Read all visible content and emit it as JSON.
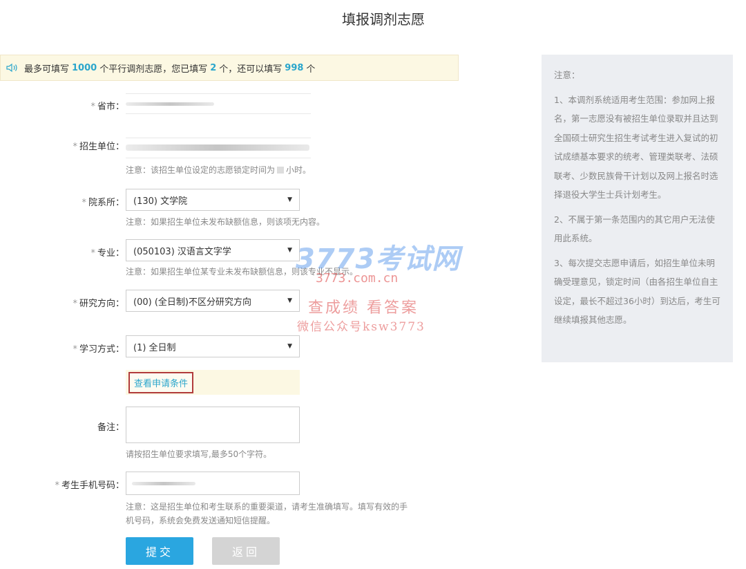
{
  "page": {
    "title": "填报调剂志愿"
  },
  "notice": {
    "prefix": "最多可填写",
    "max": "1000",
    "mid1": "个平行调剂志愿，您已填写",
    "filled": "2",
    "mid2": "个，还可以填写",
    "remaining": "998",
    "suffix": "个"
  },
  "form": {
    "required_mark": "*",
    "province_label": "省市：",
    "unit_label": "招生单位：",
    "unit_hint": "注意：该招生单位设定的志愿锁定时间为",
    "unit_hint_suffix": "小时。",
    "dept_label": "院系所：",
    "dept_value": "(130) 文学院",
    "dept_hint": "注意：如果招生单位未发布缺额信息，则该项无内容。",
    "major_label": "专业：",
    "major_value": "(050103) 汉语言文字学",
    "major_hint": "注意：如果招生单位某专业未发布缺额信息，则该专业不显示。",
    "direction_label": "研究方向：",
    "direction_value": "(00) (全日制)不区分研究方向",
    "mode_label": "学习方式：",
    "mode_value": "(1) 全日制",
    "conditions_link": "查看申请条件",
    "remark_label": "备注：",
    "remark_hint": "请按招生单位要求填写,最多50个字符。",
    "phone_label": "考生手机号码：",
    "phone_hint_line1": "注意：这是招生单位和考生联系的重要渠道，请考生准确填写。填写有效的手",
    "phone_hint_line2": "机号码，系统会免费发送通知短信提醒。",
    "submit": "提交",
    "back": "返回"
  },
  "sidebar": {
    "title": "注意：",
    "p1": "1、本调剂系统适用考生范围：参加网上报名，第一志愿没有被招生单位录取并且达到全国硕士研究生招生考试考生进入复试的初试成绩基本要求的统考、管理类联考、法硕联考、少数民族骨干计划以及网上报名时选择退役大学生士兵计划考生。",
    "p2": "2、不属于第一条范围内的其它用户无法使用此系统。",
    "p3": "3、每次提交志愿申请后，如招生单位未明确受理意见，锁定时间（由各招生单位自主设定，最长不超过36小时）到达后，考生可继续填报其他志愿。"
  },
  "watermark": {
    "line1": "3773考试网",
    "line2": "3773.com.cn",
    "line3": "查成绩 看答案",
    "line4": "微信公众号ksw3773"
  }
}
